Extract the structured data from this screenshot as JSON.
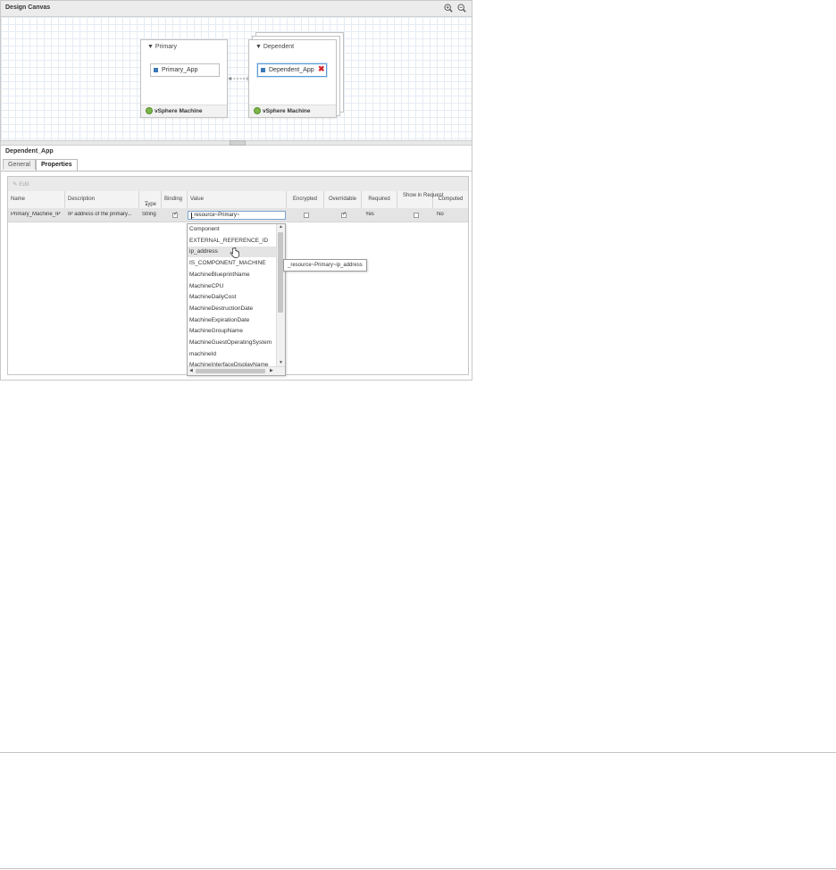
{
  "canvas": {
    "title": "Design Canvas",
    "icons": {
      "zoom_in": "zoom-in-icon",
      "zoom_out": "zoom-out-icon"
    }
  },
  "machines": [
    {
      "name": "Primary",
      "app": "Primary_App",
      "footer": "vSphere Machine"
    },
    {
      "name": "Dependent",
      "app": "Dependent_App",
      "footer": "vSphere Machine"
    }
  ],
  "panel": {
    "title": "Dependent_App",
    "tabs": [
      "General",
      "Properties"
    ],
    "active_tab": "Properties"
  },
  "grid": {
    "toolbar": {
      "edit_label": "Edit"
    },
    "columns": [
      "Name",
      "Description",
      "Type",
      "Binding",
      "Value",
      "Encrypted",
      "Overridable",
      "Required",
      "Show in Request",
      "Computed"
    ],
    "sort_indicator": "▲",
    "row": {
      "name": "Primary_Machine_IP",
      "description": "IP address of the primary...",
      "type": "String",
      "binding": true,
      "value": "_resource~Primary~",
      "encrypted": false,
      "overridable": true,
      "required": "Yes",
      "show_in_request": false,
      "computed": "No"
    }
  },
  "dropdown": {
    "items": [
      "Component",
      "EXTERNAL_REFERENCE_ID",
      "ip_address",
      "IS_COMPONENT_MACHINE",
      "MachineBlueprintName",
      "MachineCPU",
      "MachineDailyCost",
      "MachineDestructionDate",
      "MachineExpirationDate",
      "MachineGroupName",
      "MachineGuestOperatingSystem",
      "machineId",
      "MachineInterfaceDisplayName"
    ],
    "hovered_index": 2
  },
  "tooltip": "_resource~Primary~ip_address",
  "colors": {
    "accent": "#3a78b7",
    "remove": "#d3272c",
    "vsphere_green": "#7ab648"
  }
}
